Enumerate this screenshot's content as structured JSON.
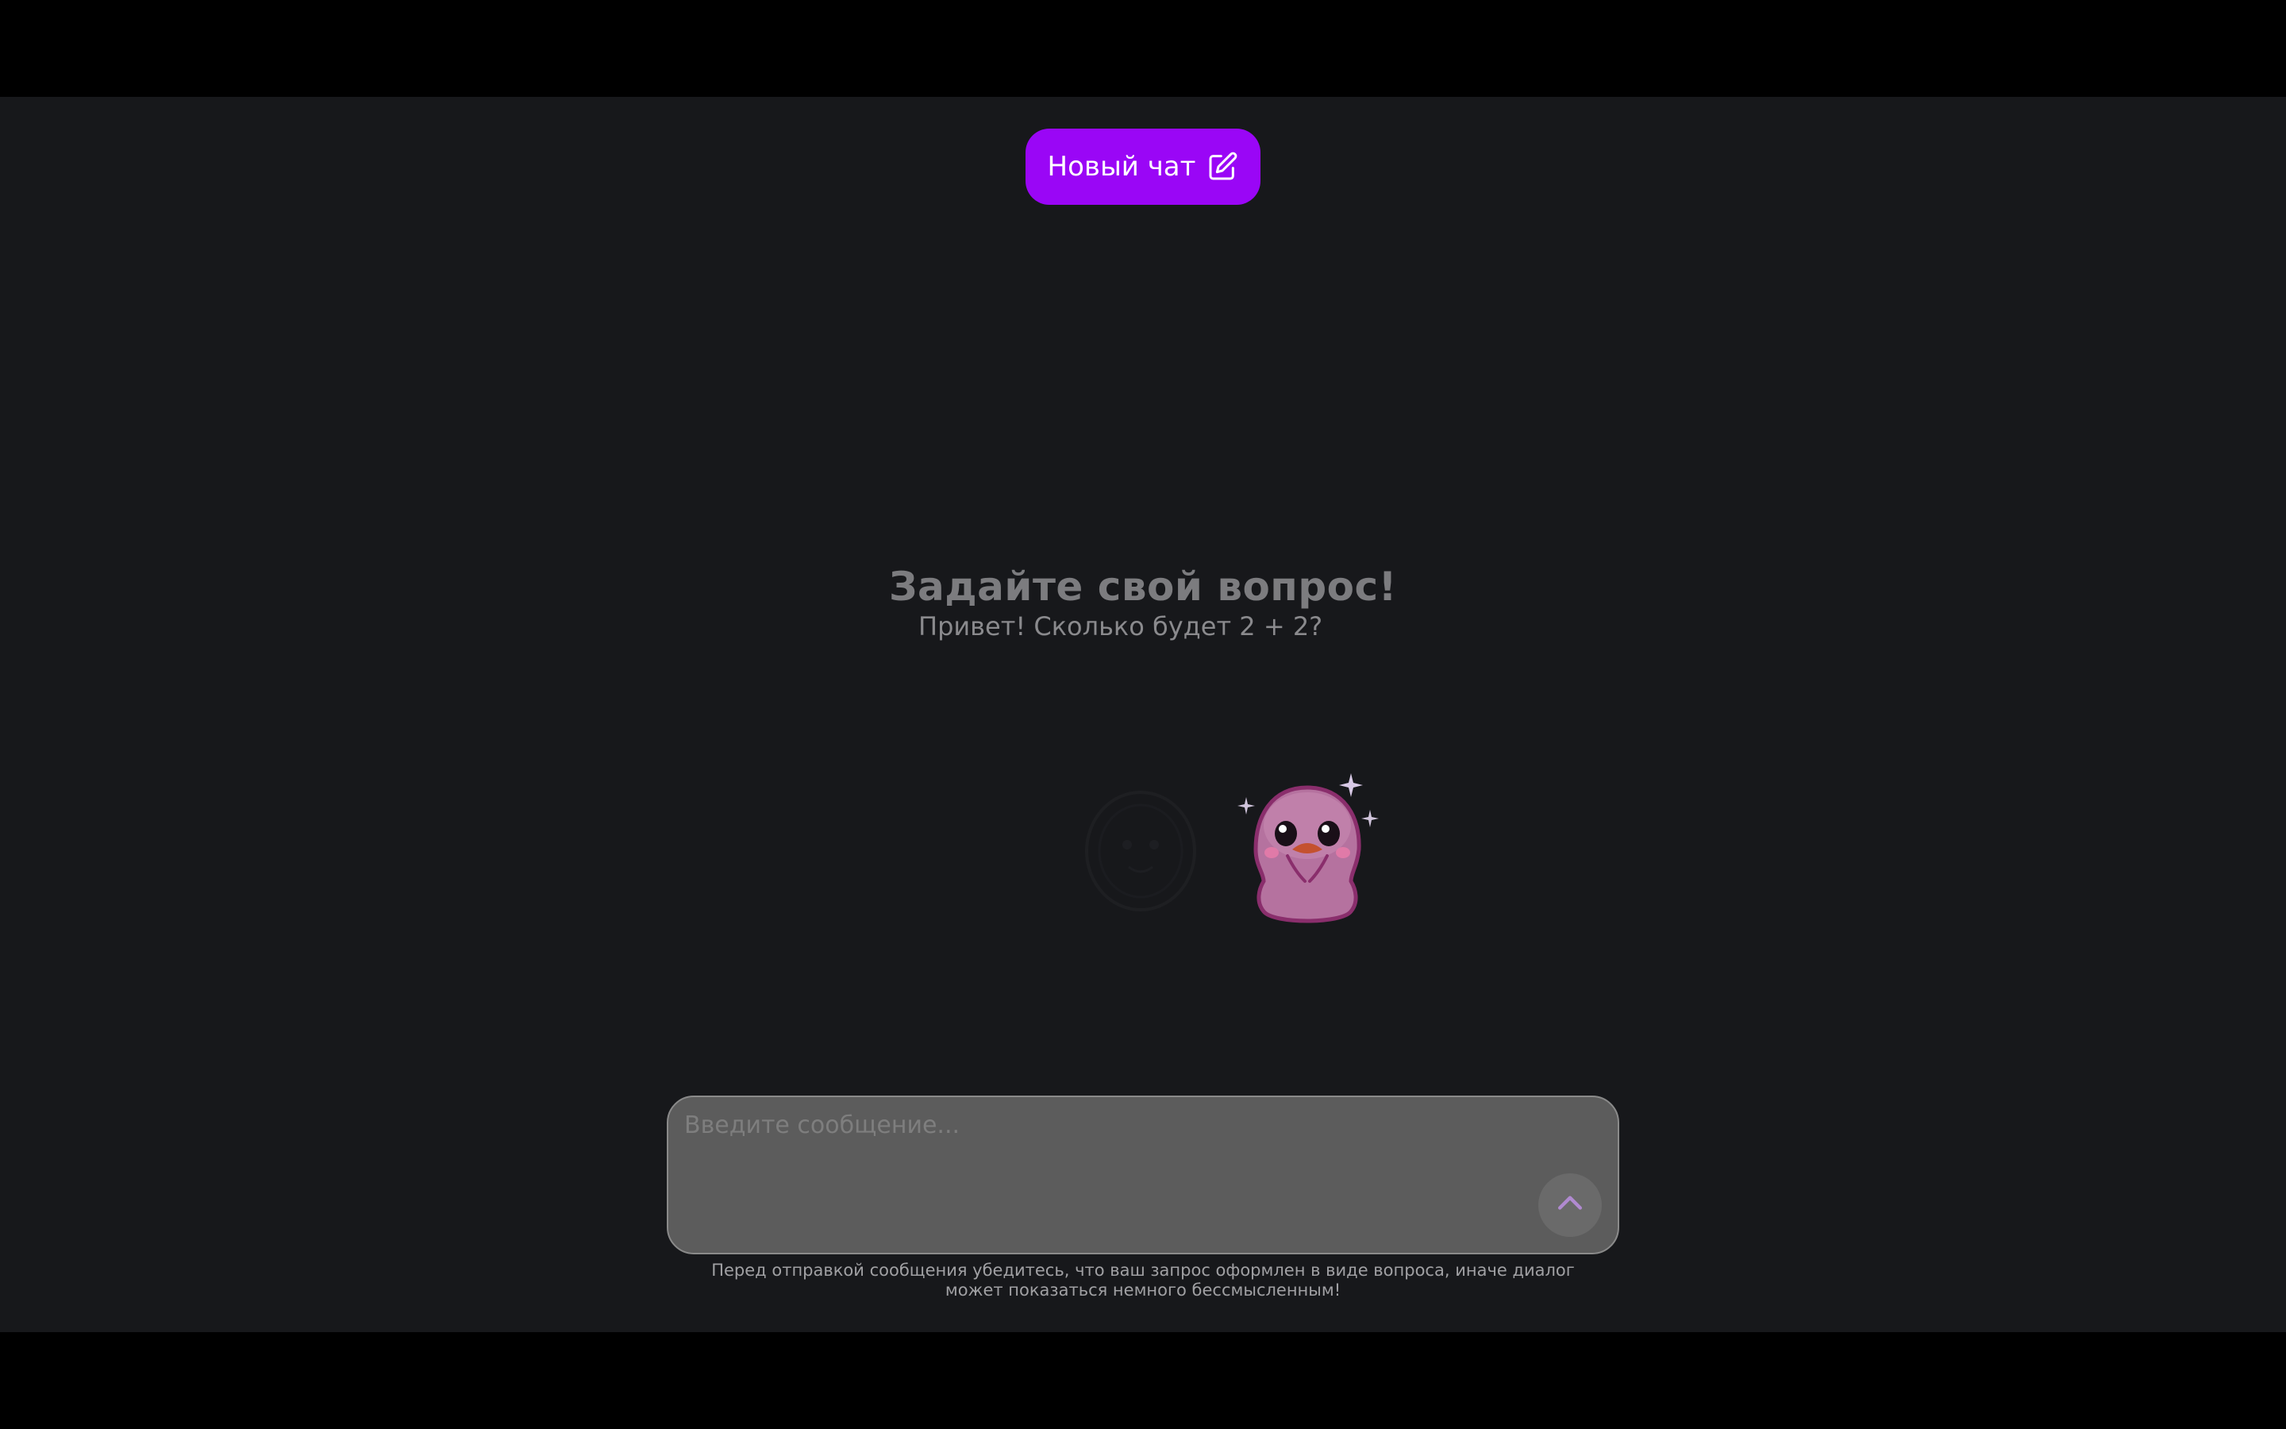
{
  "header": {
    "new_chat_label": "Новый чат",
    "new_chat_icon": "edit-icon"
  },
  "empty_state": {
    "title": "Задайте свой вопрос!",
    "example_prompt": "Привет! Сколько будет 2 + 2?"
  },
  "composer": {
    "placeholder": "Введите сообщение...",
    "send_icon": "chevron-up-icon"
  },
  "disclaimer": "Перед отправкой сообщения убедитесь, что ваш запрос оформлен в виде вопроса, иначе диалог может показаться немного бессмысленным!",
  "colors": {
    "accent": "#9a06f6",
    "background": "#17181b",
    "composer": "#5c5c5c"
  }
}
